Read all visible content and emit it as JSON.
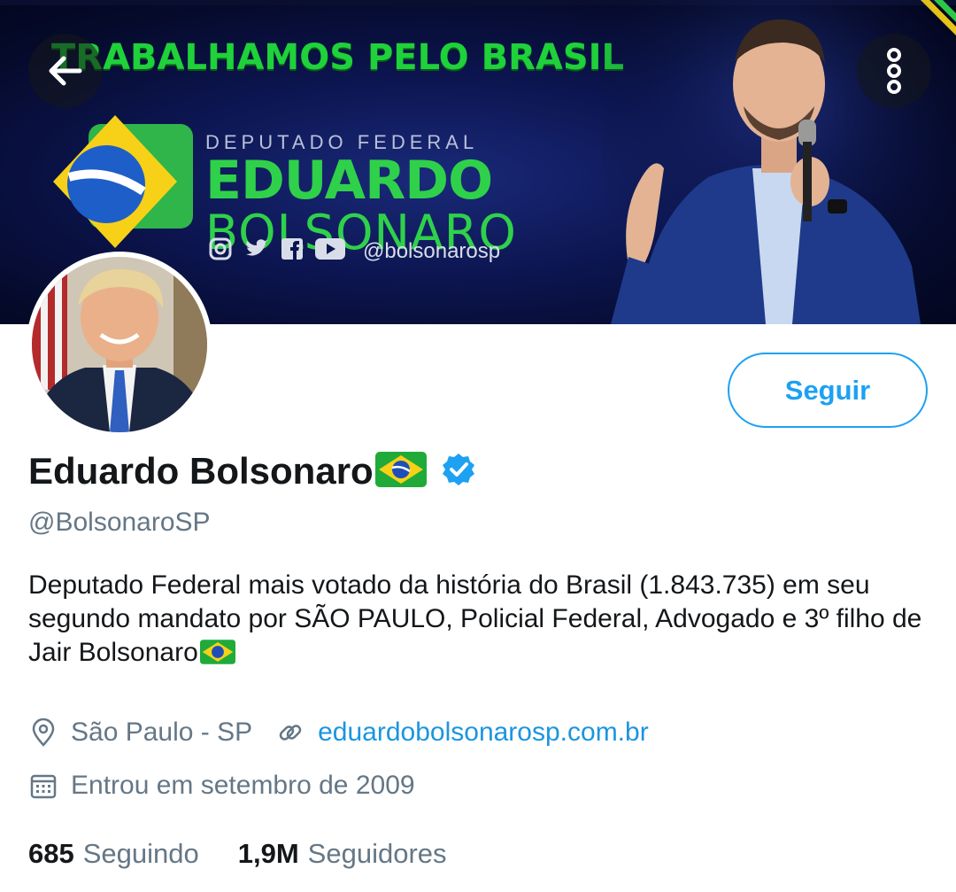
{
  "banner": {
    "headline": "TRABALHAMOS PELO BRASIL",
    "logo_sub": "DEPUTADO FEDERAL",
    "logo_first": "EDUARDO",
    "logo_last": "BOLSONARO",
    "social_handle": "@bolsonarosp",
    "colors": {
      "green": "#2fd14a",
      "yellow": "#f7d117",
      "navy": "#0c1550"
    }
  },
  "profile": {
    "display_name": "Eduardo Bolsonaro",
    "handle": "@BolsonaroSP",
    "bio": "Deputado Federal mais votado da história do Brasil (1.843.735) em seu segundo mandato por SÃO PAULO, Policial Federal, Advogado e 3º filho de Jair Bolsonaro",
    "location": "São Paulo - SP",
    "website": "eduardobolsonarosp.com.br",
    "joined": "Entrou em setembro de 2009"
  },
  "actions": {
    "follow_label": "Seguir"
  },
  "stats": {
    "following_count": "685",
    "following_label": "Seguindo",
    "followers_count": "1,9M",
    "followers_label": "Seguidores"
  },
  "icons": {
    "back": "arrow-left-icon",
    "more": "more-vertical-icon",
    "verified": "verified-badge-icon",
    "location": "location-pin-icon",
    "link": "link-icon",
    "calendar": "calendar-icon",
    "flag": "brazil-flag-emoji"
  },
  "accent_color": "#1da1f2"
}
